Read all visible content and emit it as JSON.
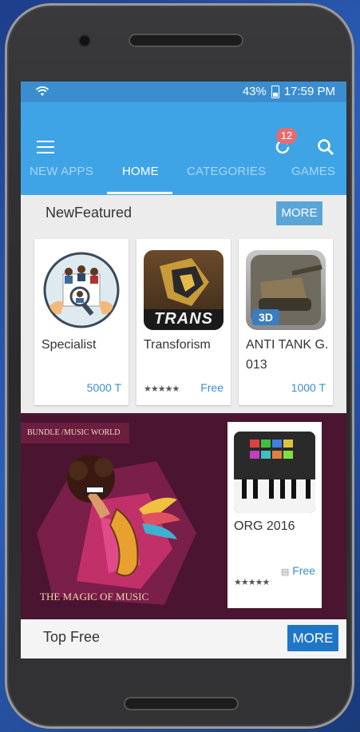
{
  "status_bar": {
    "battery": "43%",
    "time": "17:59 PM"
  },
  "appbar": {
    "notification_count": "12"
  },
  "tabs": [
    {
      "label": "NEW APPS"
    },
    {
      "label": "HOME"
    },
    {
      "label": "CATEGORIES"
    },
    {
      "label": "GAMES"
    }
  ],
  "active_tab": "HOME",
  "new_featured": {
    "title": "NewFeatured",
    "more_label": "MORE",
    "apps": [
      {
        "name": "Specialist",
        "price": "5000 T"
      },
      {
        "name": "Transforism",
        "rating": "★★★★★",
        "price": "Free",
        "icon_text": "TRANS"
      },
      {
        "name": "ANTI TANK G. 013",
        "price": "1000 T",
        "icon_text": "3D"
      }
    ]
  },
  "banner": {
    "tag": "BUNDLE /MUSIC WORLD",
    "caption": "THE MAGIC OF MUSIC",
    "app": {
      "name": "ORG 2016",
      "price": "Free",
      "rating": "★★★★★"
    }
  },
  "top_free": {
    "title": "Top Free",
    "more_label": "MORE"
  },
  "colors": {
    "appbar": "#3fa4e6",
    "status_bar": "#3a8ed0",
    "badge": "#e76c70",
    "price": "#3a8ed0",
    "banner_bg": "#4b1430",
    "more_button_dark": "#1f76c7"
  }
}
